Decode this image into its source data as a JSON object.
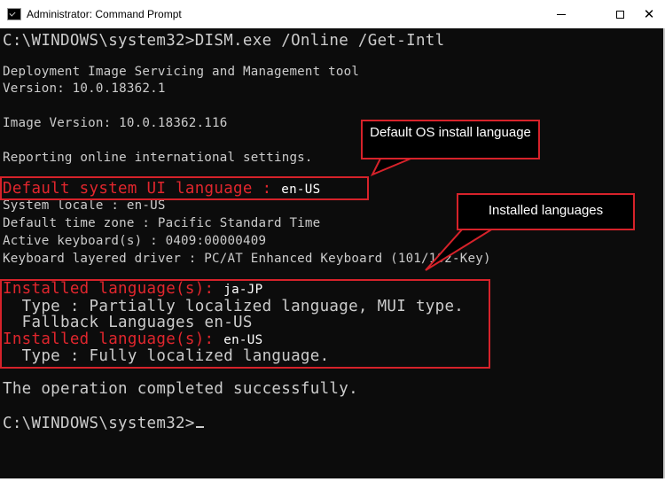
{
  "window": {
    "title": "Administrator: Command Prompt",
    "app_icon": "cmd-icon",
    "controls": {
      "minimize": "minimize-icon",
      "maximize": "maximize-icon",
      "close": "close-icon"
    }
  },
  "console": {
    "prompt_line": "C:\\WINDOWS\\system32>DISM.exe /Online /Get-Intl",
    "tool_name": "Deployment Image Servicing and Management tool",
    "version": "Version: 10.0.18362.1",
    "image_version": "Image Version: 10.0.18362.116",
    "reporting": "Reporting online international settings.",
    "default_ui_label": "Default system UI language : ",
    "default_ui_value": "en-US",
    "system_locale": "System locale : en-US",
    "time_zone": "Default time zone : Pacific Standard Time",
    "keyboards": "Active keyboard(s) : 0409:00000409",
    "layered_driver": "Keyboard layered driver : PC/AT Enhanced Keyboard (101/102-Key)",
    "installed_label": "Installed language(s): ",
    "installed_1_value": "ja-JP",
    "installed_1_type": "  Type : Partially localized language, MUI type.",
    "fallback": "  Fallback Languages en-US",
    "installed_2_value": "en-US",
    "installed_2_type": "  Type : Fully localized language.",
    "completed": "The operation completed successfully.",
    "final_prompt": "C:\\WINDOWS\\system32>"
  },
  "annotations": {
    "default_os": "Default OS install language",
    "installed_languages": "Installed languages",
    "color": "#d6222a"
  }
}
